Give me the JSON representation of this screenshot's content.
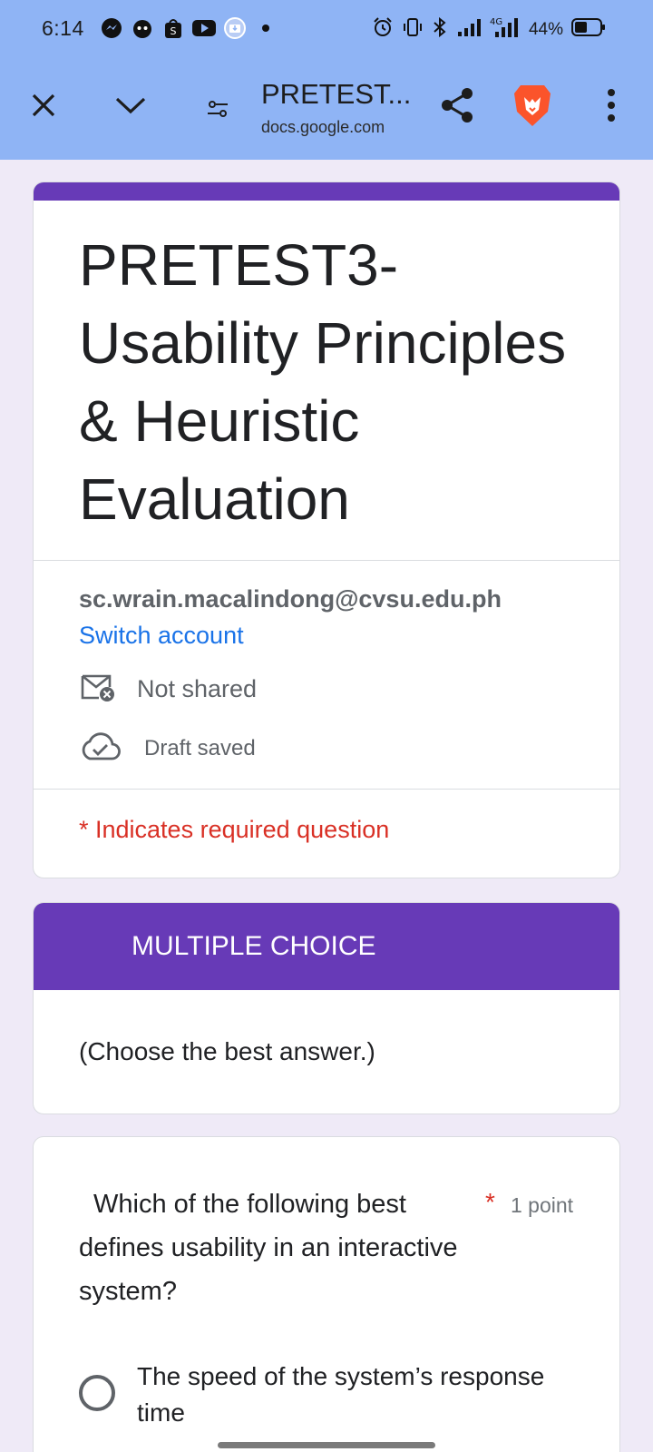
{
  "status_bar": {
    "time": "6:14",
    "battery": "44%",
    "network": "4G",
    "left_icons": [
      "messenger-icon",
      "ghost-app-icon",
      "shopee-icon",
      "youtube-icon",
      "download-icon",
      "dot-icon"
    ],
    "right_icons": [
      "alarm-icon",
      "vibrate-icon",
      "bluetooth-icon",
      "signal-icon",
      "signal-4g-icon",
      "battery-icon"
    ]
  },
  "browser": {
    "page_title": "PRETEST...",
    "url": "docs.google.com",
    "icons": [
      "close-icon",
      "chevron-down-icon",
      "tune-icon",
      "share-icon",
      "brave-lion-icon",
      "more-vert-icon"
    ]
  },
  "form": {
    "title": "PRETEST3-Usability Principles & Heuristic Evaluation",
    "accent_color": "#673ab7",
    "account": {
      "email": "sc.wrain.macalindong@cvsu.edu.ph",
      "switch_label": "Switch account",
      "shared_status": "Not shared",
      "draft_status": "Draft saved"
    },
    "required_note": "* Indicates required question",
    "section": {
      "header": "MULTIPLE CHOICE",
      "description": "(Choose the best answer.)"
    },
    "question": {
      "text": "Which of the following best defines usability in an interactive system?",
      "required_mark": "*",
      "points": "1 point",
      "options": [
        {
          "label": "The speed of the system’s response time",
          "selected": false
        }
      ]
    }
  }
}
